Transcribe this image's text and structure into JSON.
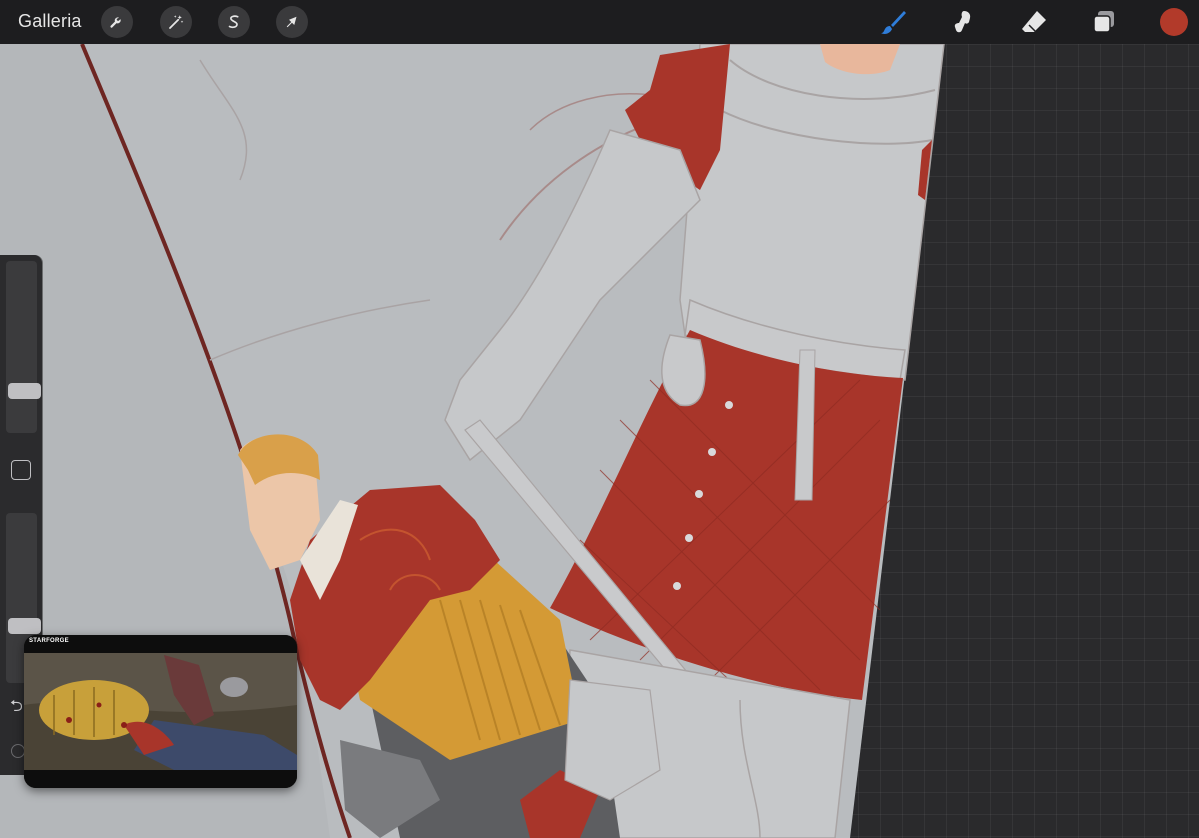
{
  "toolbar": {
    "gallery_label": "Galleria",
    "left_tools": [
      {
        "name": "actions",
        "icon": "wrench-icon"
      },
      {
        "name": "adjustments",
        "icon": "magic-wand-icon"
      },
      {
        "name": "selection",
        "icon": "selection-s-icon"
      },
      {
        "name": "transform",
        "icon": "arrow-cursor-icon"
      }
    ],
    "right_tools": [
      {
        "name": "brush",
        "icon": "brush-icon",
        "active": true
      },
      {
        "name": "smudge",
        "icon": "smudge-icon",
        "active": false
      },
      {
        "name": "eraser",
        "icon": "eraser-icon",
        "active": false
      },
      {
        "name": "layers",
        "icon": "layers-icon",
        "active": false
      }
    ],
    "active_color": "#b23a2a",
    "active_tool_color": "#2f7dd9"
  },
  "sidebar": {
    "brush_size_level": 0.78,
    "opacity_level": 0.68,
    "icons": [
      "square-modify-icon",
      "undo-arrow-icon",
      "redo-icon"
    ],
    "undo_glyph": "⮌"
  },
  "reference": {
    "logo_text": "STARFORGE"
  },
  "colors": {
    "canvas_gray": "#b9bcbf",
    "red_cloth": "#a8352a",
    "mustard": "#d49a35",
    "sketch_line": "#9a7a78"
  }
}
